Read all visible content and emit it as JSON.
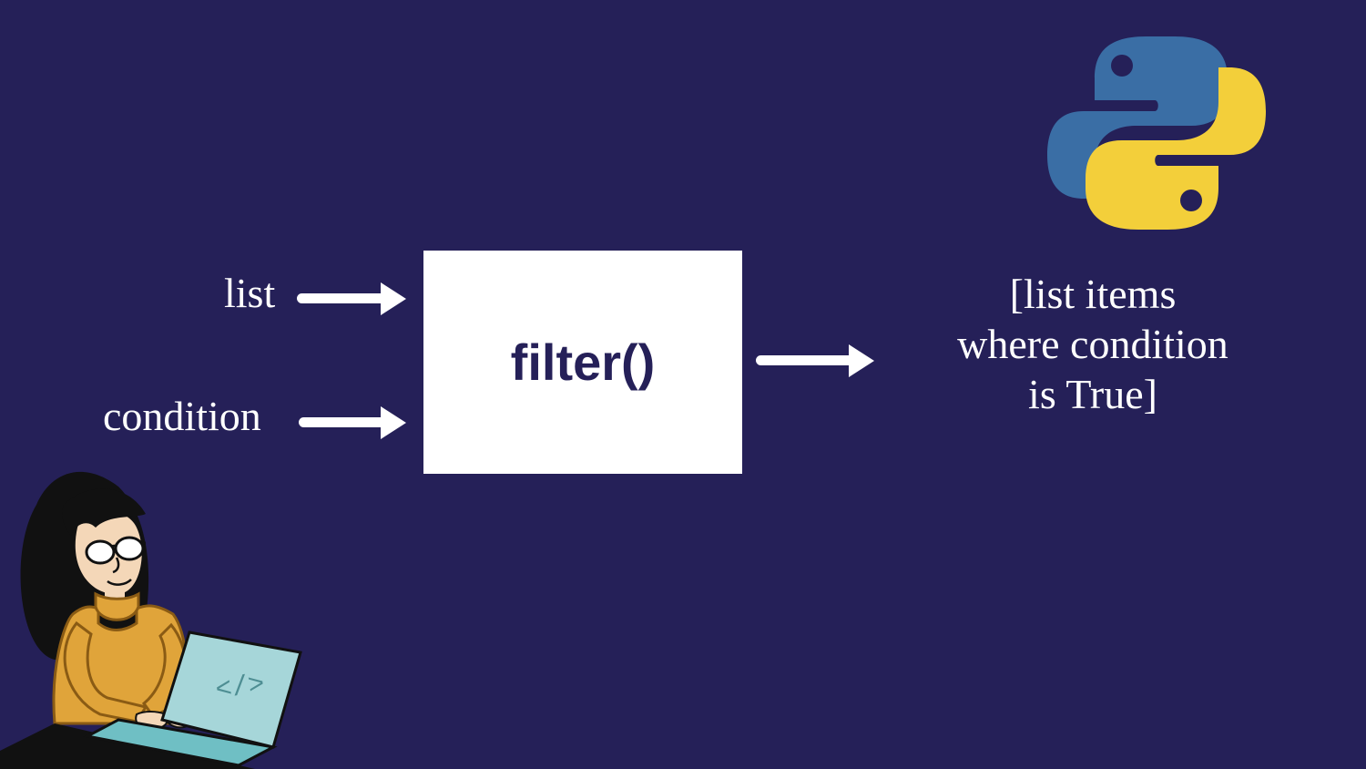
{
  "inputs": {
    "list_label": "list",
    "condition_label": "condition"
  },
  "function": {
    "name": "filter()"
  },
  "output": {
    "line1": "[list items",
    "line2": "where condition",
    "line3": "is True]"
  },
  "icons": {
    "python_logo": "python-logo-icon",
    "coder": "person-coding-icon"
  },
  "colors": {
    "background": "#252058",
    "box": "#ffffff",
    "text_light": "#ffffff",
    "text_dark": "#252058",
    "python_blue": "#3a6ea5",
    "python_yellow": "#f3cf3a",
    "sweater": "#e0a43a",
    "laptop": "#a6d6d9"
  }
}
